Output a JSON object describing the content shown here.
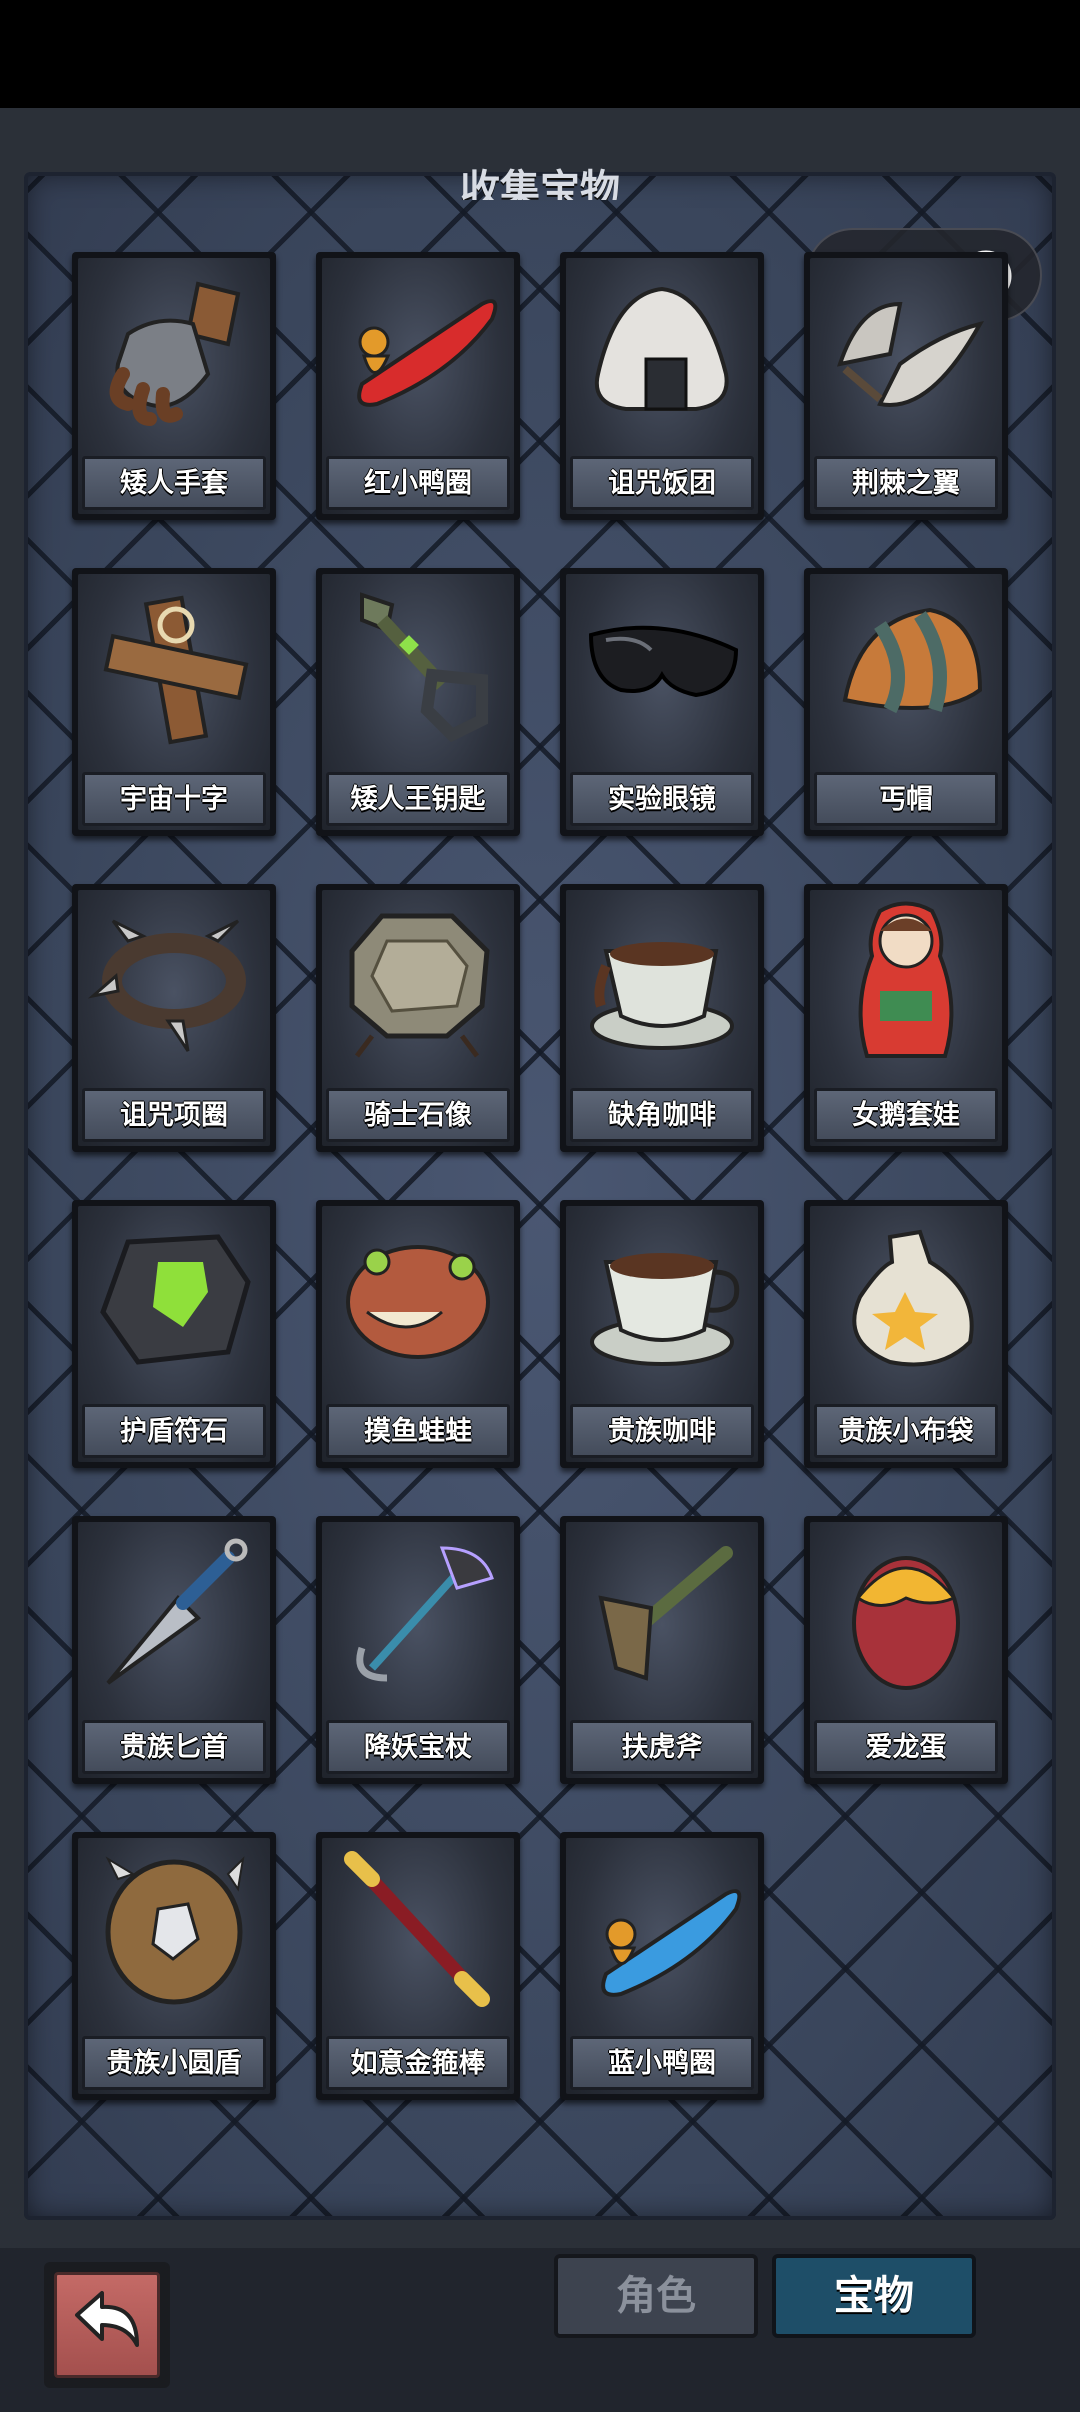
{
  "panel": {
    "title": "收集宝物"
  },
  "items": [
    {
      "name": "矮人手套",
      "icon": "gauntlet-icon"
    },
    {
      "name": "红小鸭圈",
      "icon": "red-duck-ring-icon"
    },
    {
      "name": "诅咒饭团",
      "icon": "rice-ball-icon"
    },
    {
      "name": "荆棘之翼",
      "icon": "thorn-wing-icon"
    },
    {
      "name": "宇宙十字",
      "icon": "wooden-cross-icon"
    },
    {
      "name": "矮人王钥匙",
      "icon": "key-icon"
    },
    {
      "name": "实验眼镜",
      "icon": "goggles-icon"
    },
    {
      "name": "丐帽",
      "icon": "beanie-icon"
    },
    {
      "name": "诅咒项圈",
      "icon": "spiked-collar-icon"
    },
    {
      "name": "骑士石像",
      "icon": "stone-plaque-icon"
    },
    {
      "name": "缺角咖啡",
      "icon": "chipped-coffee-icon"
    },
    {
      "name": "女鹅套娃",
      "icon": "matryoshka-icon"
    },
    {
      "name": "护盾符石",
      "icon": "rune-stone-icon"
    },
    {
      "name": "摸鱼蛙蛙",
      "icon": "frog-icon"
    },
    {
      "name": "贵族咖啡",
      "icon": "coffee-icon"
    },
    {
      "name": "贵族小布袋",
      "icon": "cloth-bag-icon"
    },
    {
      "name": "贵族匕首",
      "icon": "dagger-icon"
    },
    {
      "name": "降妖宝杖",
      "icon": "staff-icon"
    },
    {
      "name": "扶虎斧",
      "icon": "axe-icon"
    },
    {
      "name": "爱龙蛋",
      "icon": "dragon-egg-icon"
    },
    {
      "name": "贵族小圆盾",
      "icon": "round-shield-icon"
    },
    {
      "name": "如意金箍棒",
      "icon": "golden-staff-icon"
    },
    {
      "name": "蓝小鸭圈",
      "icon": "blue-duck-ring-icon"
    }
  ],
  "tabs": {
    "role": "角色",
    "treasure": "宝物",
    "active": "treasure"
  },
  "icons": {
    "back": "back-arrow-icon",
    "more": "more-dots-icon",
    "close": "target-icon"
  }
}
